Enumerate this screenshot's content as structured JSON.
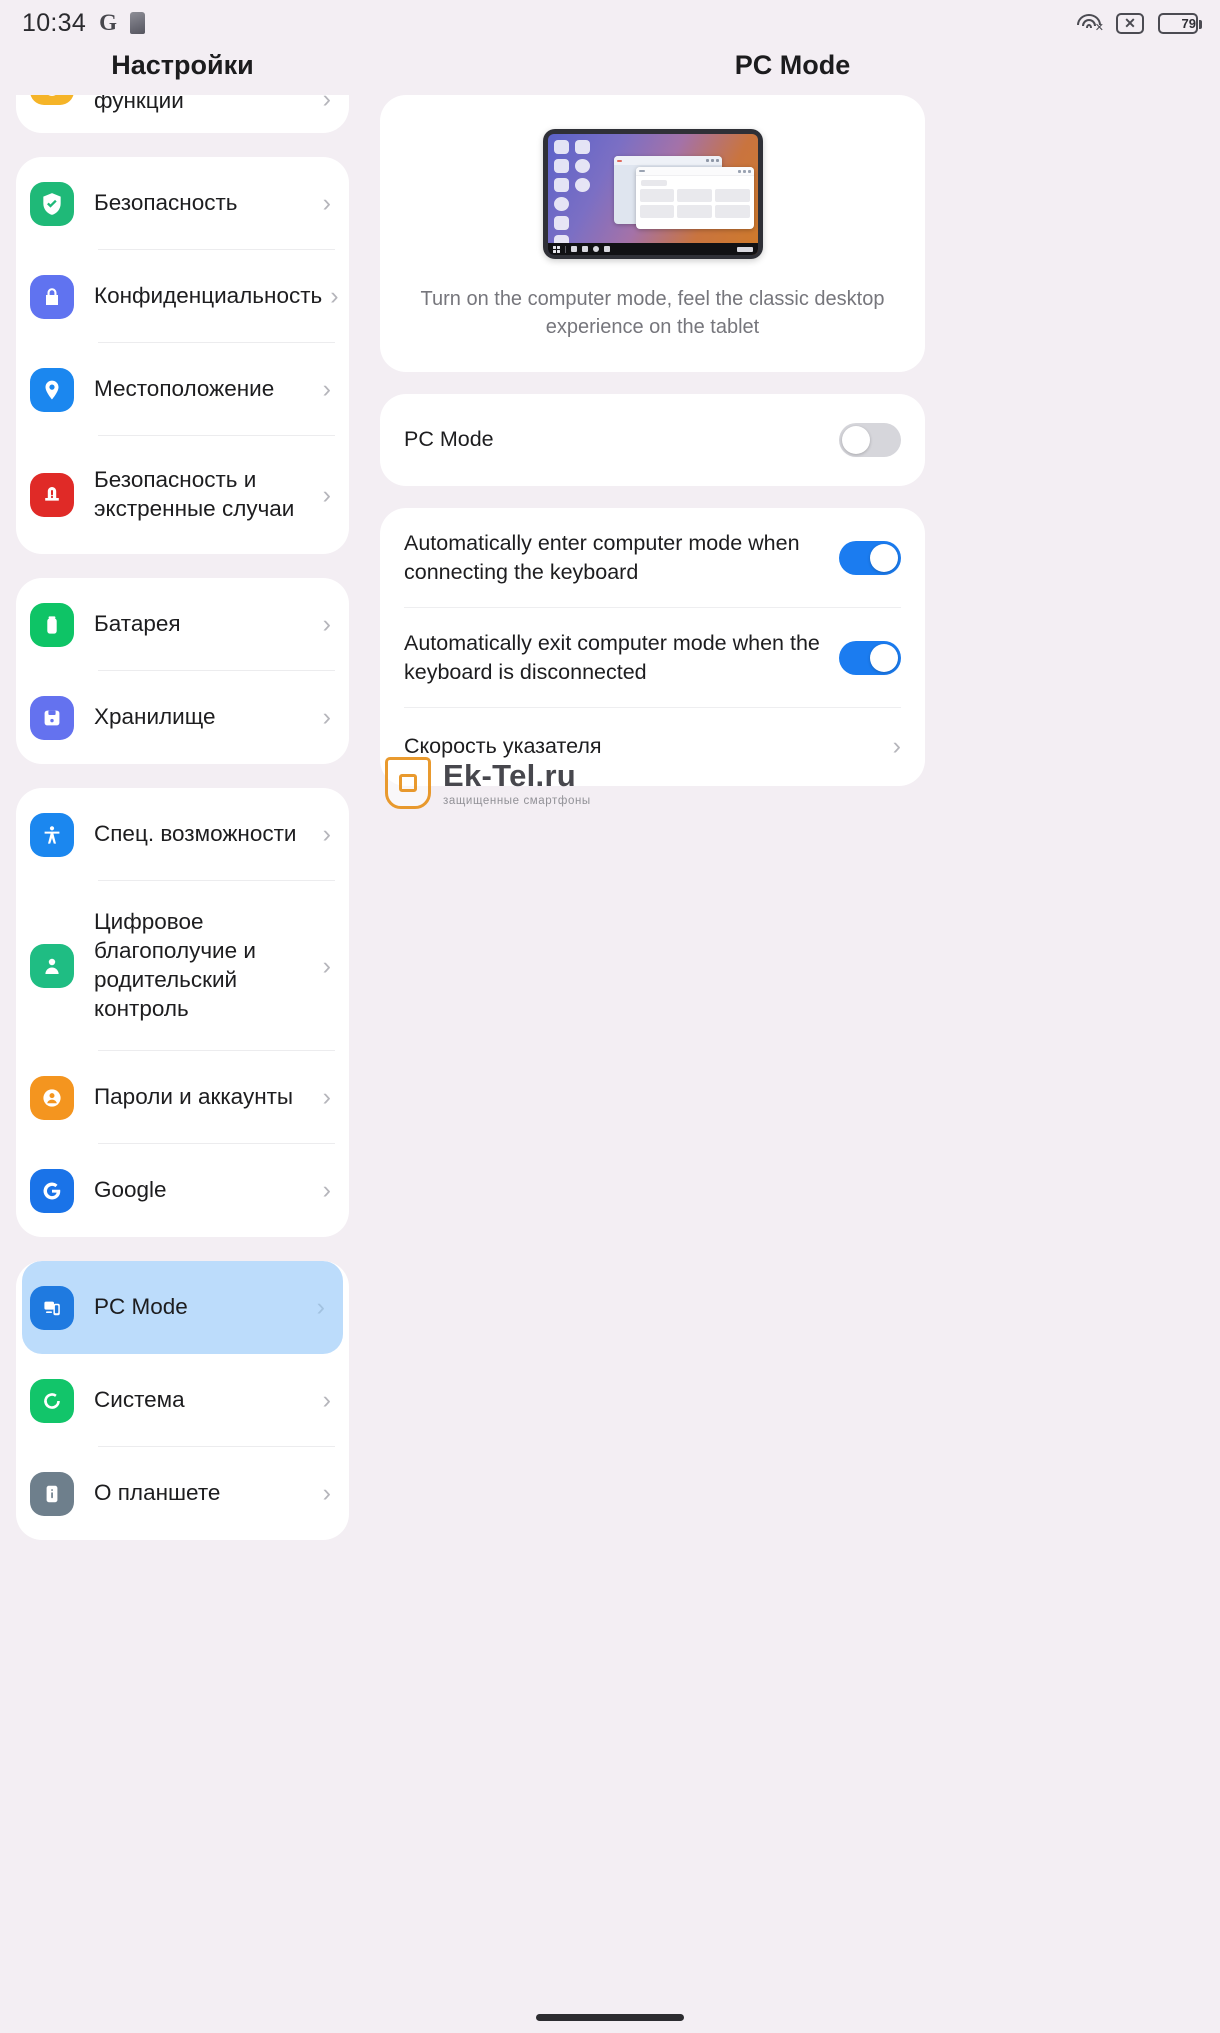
{
  "statusbar": {
    "time": "10:34",
    "google_icon": "G",
    "sim_icon": "sim-card-icon",
    "wifi_icon": "wifi-icon",
    "signal_off_icon": "signal-x-icon",
    "battery_level": "79"
  },
  "left": {
    "title": "Настройки",
    "groups": [
      {
        "clipped": true,
        "items": [
          {
            "label": "функции",
            "icon": "feature-icon",
            "color": "ic-yellow"
          }
        ]
      },
      {
        "items": [
          {
            "label": "Безопасность",
            "icon": "shield-check-icon",
            "color": "ic-green"
          },
          {
            "label": "Конфиденциальность",
            "icon": "lock-icon",
            "color": "ic-purple"
          },
          {
            "label": "Местоположение",
            "icon": "location-pin-icon",
            "color": "ic-blue"
          },
          {
            "label": "Безопасность и экстренные случаи",
            "icon": "emergency-icon",
            "color": "ic-red"
          }
        ]
      },
      {
        "items": [
          {
            "label": "Батарея",
            "icon": "battery-icon",
            "color": "ic-green2"
          },
          {
            "label": "Хранилище",
            "icon": "storage-icon",
            "color": "ic-indigo"
          }
        ]
      },
      {
        "items": [
          {
            "label": "Спец. возможности",
            "icon": "accessibility-icon",
            "color": "ic-cyan"
          },
          {
            "label": "Цифровое благополучие и родительский контроль",
            "icon": "wellbeing-icon",
            "color": "ic-teal"
          },
          {
            "label": "Пароли и аккаунты",
            "icon": "account-icon",
            "color": "ic-orange"
          },
          {
            "label": "Google",
            "icon": "google-icon",
            "color": "ic-gblue"
          }
        ]
      },
      {
        "items": [
          {
            "label": "PC Mode",
            "icon": "pc-mode-icon",
            "color": "ic-pcblue",
            "selected": true
          },
          {
            "label": "Система",
            "icon": "system-update-icon",
            "color": "ic-sgreen"
          },
          {
            "label": "О планшете",
            "icon": "about-tablet-icon",
            "color": "ic-gray"
          }
        ]
      }
    ]
  },
  "right": {
    "title": "PC Mode",
    "hero": {
      "illustration": "tablet-desktop-illustration",
      "description": "Turn on the computer mode, feel the classic desktop experience on the tablet"
    },
    "pc_mode_row": {
      "label": "PC Mode",
      "enabled": false
    },
    "options": [
      {
        "label": "Automatically enter computer mode when connecting the keyboard",
        "enabled": true,
        "type": "toggle"
      },
      {
        "label": "Automatically exit computer mode when the keyboard is disconnected",
        "enabled": true,
        "type": "toggle"
      },
      {
        "label": "Скорость указателя",
        "type": "link"
      }
    ]
  },
  "watermark": {
    "name": "Ek-Tel.ru",
    "tagline": "защищенные смартфоны"
  },
  "colors": {
    "accent_blue": "#1b7cf0",
    "selected_row": "#bcdcfb",
    "page_bg": "#f3eef3",
    "card_bg": "#ffffff"
  }
}
